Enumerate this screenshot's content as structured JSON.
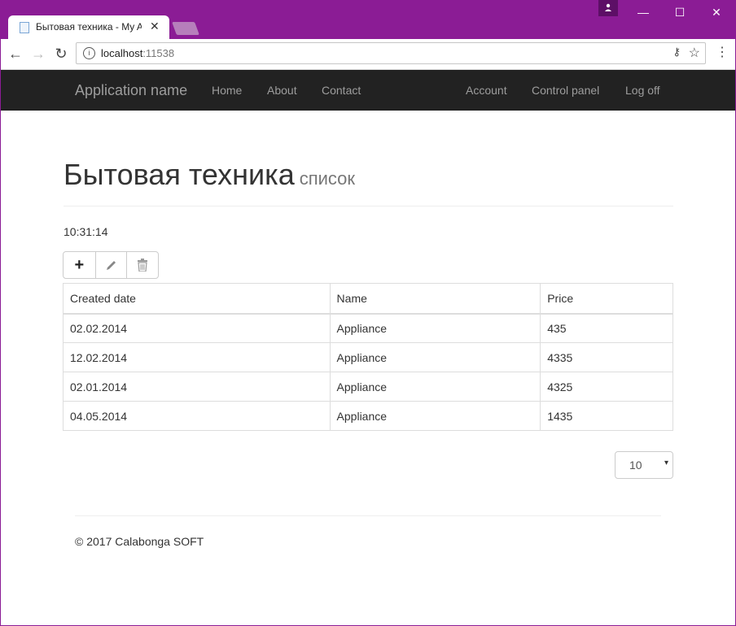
{
  "browser": {
    "tab_title": "Бытовая техника - My A",
    "tab_close": "✕",
    "profile_icon": "person-icon",
    "minimize": "—",
    "maximize": "☐",
    "close": "✕",
    "back": "←",
    "forward": "→",
    "reload": "↻",
    "info": "i",
    "url_host": "localhost",
    "url_port": ":11538",
    "key": "⚷",
    "star": "☆",
    "menu": "⋮"
  },
  "navbar": {
    "brand": "Application name",
    "left_links": [
      "Home",
      "About",
      "Contact"
    ],
    "right_links": [
      "Account",
      "Control panel",
      "Log off"
    ]
  },
  "page": {
    "title": "Бытовая техника",
    "subtitle": "список",
    "time": "10:31:14"
  },
  "toolbar": {
    "add": "+",
    "edit_icon": "pencil-icon",
    "delete_icon": "trash-icon"
  },
  "table": {
    "columns": [
      "Created date",
      "Name",
      "Price"
    ],
    "rows": [
      [
        "02.02.2014",
        "Appliance",
        "435"
      ],
      [
        "12.02.2014",
        "Appliance",
        "4335"
      ],
      [
        "02.01.2014",
        "Appliance",
        "4325"
      ],
      [
        "04.05.2014",
        "Appliance",
        "1435"
      ]
    ]
  },
  "pager": {
    "value": "10",
    "caret": "▾"
  },
  "footer": {
    "text": "© 2017 Calabonga SOFT"
  },
  "colors": {
    "window_frame": "#8b1c95",
    "navbar_bg": "#222222",
    "navbar_text": "#9d9d9d"
  }
}
